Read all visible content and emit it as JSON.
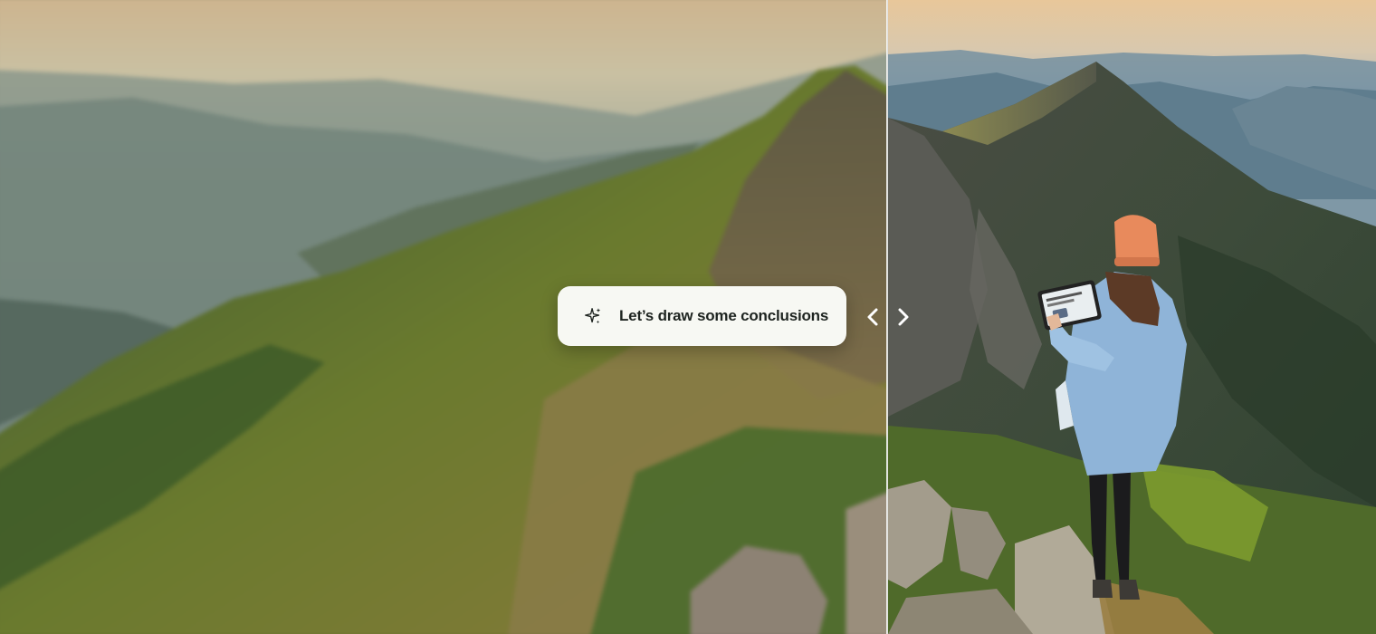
{
  "prompt": {
    "text": "Let’s draw some conclusions",
    "icon": "sparkle-icon"
  },
  "comparison": {
    "left_icon": "chevron-left-icon",
    "right_icon": "chevron-right-icon"
  },
  "colors": {
    "pill_background": "#f7f8f3",
    "pill_text": "#1e2420",
    "sky_top": "#e8c79a",
    "jacket": "#8fb4d8",
    "beanie": "#e88a5c",
    "grass": "#6f8a2a"
  }
}
